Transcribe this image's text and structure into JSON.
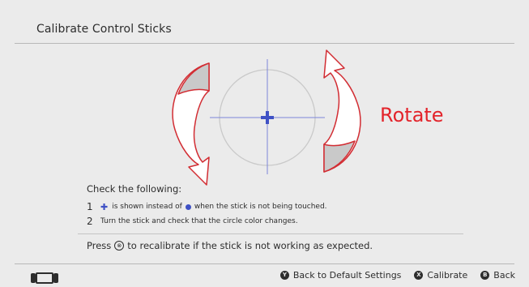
{
  "header": {
    "title": "Calibrate Control Sticks"
  },
  "stage": {
    "rotate_label": "Rotate"
  },
  "checks": {
    "heading": "Check the following:",
    "items": [
      {
        "number": "1",
        "prefix_icon": "plus-icon",
        "text_a": "is shown instead of",
        "inline_icon": "blue-dot-icon",
        "text_b": "when the stick is not being touched."
      },
      {
        "number": "2",
        "text": "Turn the stick and check that the circle color changes."
      }
    ]
  },
  "recalibrate": {
    "text_before": "Press",
    "button_glyph": "⊗",
    "text_after": "to recalibrate if the stick is not working as expected."
  },
  "footer": {
    "actions": [
      {
        "badge": "Y",
        "label": "Back to Default Settings"
      },
      {
        "badge": "X",
        "label": "Calibrate"
      },
      {
        "badge": "B",
        "label": "Back"
      }
    ]
  },
  "colors": {
    "accent_red": "#e3242b",
    "crosshair_blue": "#3f51c5",
    "background": "#ebebeb"
  }
}
